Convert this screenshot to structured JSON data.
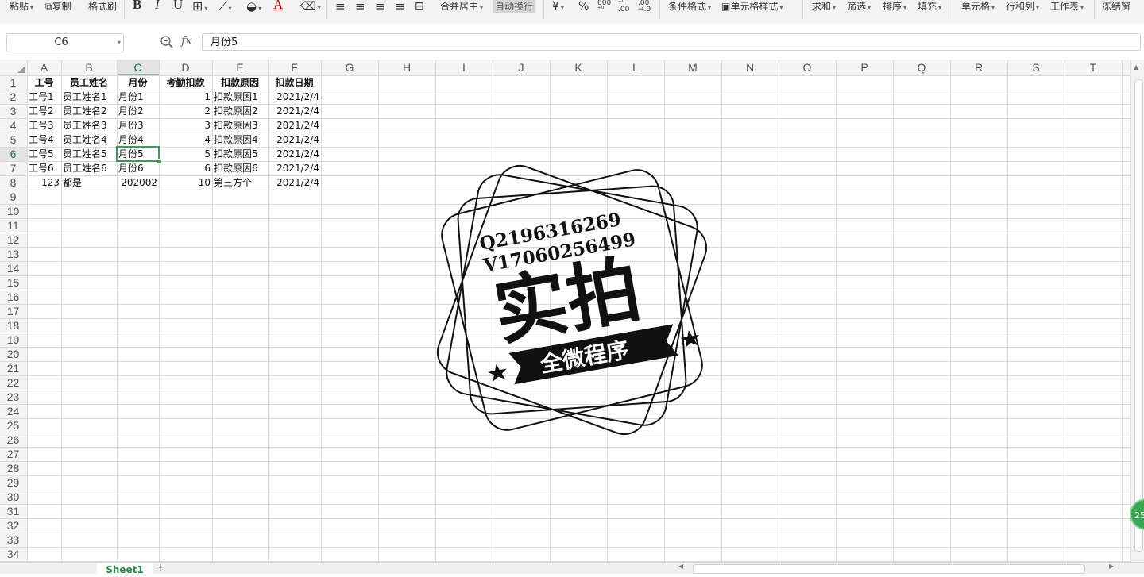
{
  "ribbon": {
    "paste": "粘贴",
    "copy": "复制",
    "format_painter": "格式刷",
    "merge_center": "合并居中",
    "wrap_text": "自动换行",
    "currency": "¥",
    "percent": "%",
    "cond_format": "条件格式",
    "cell_style": "单元格样式",
    "sum": "求和",
    "filter": "筛选",
    "sort": "排序",
    "fill": "填充",
    "cell": "单元格",
    "row_col": "行和列",
    "worksheet": "工作表",
    "freeze": "冻结窗"
  },
  "formula_bar": {
    "name_box": "C6",
    "fx_label": "fx",
    "formula": "月份5"
  },
  "columns": [
    "A",
    "B",
    "C",
    "D",
    "E",
    "F",
    "G",
    "H",
    "I",
    "J",
    "K",
    "L",
    "M",
    "N",
    "O",
    "P",
    "Q",
    "R",
    "S",
    "T"
  ],
  "rows": [
    "1",
    "2",
    "3",
    "4",
    "5",
    "6",
    "7",
    "8",
    "9",
    "10",
    "11",
    "12",
    "13",
    "14",
    "15",
    "16",
    "17",
    "18",
    "19",
    "20",
    "21",
    "22",
    "23",
    "24",
    "25",
    "26",
    "27",
    "28",
    "29",
    "30",
    "31",
    "32",
    "33",
    "34"
  ],
  "selected_cell": {
    "col": "C",
    "row": "6"
  },
  "table": {
    "headers": [
      "工号",
      "员工姓名",
      "月份",
      "考勤扣款",
      "扣款原因",
      "扣款日期"
    ],
    "rows": [
      [
        "工号1",
        "员工姓名1",
        "月份1",
        "1",
        "扣款原因1",
        "2021/2/4"
      ],
      [
        "工号2",
        "员工姓名2",
        "月份2",
        "2",
        "扣款原因2",
        "2021/2/4"
      ],
      [
        "工号3",
        "员工姓名3",
        "月份3",
        "3",
        "扣款原因3",
        "2021/2/4"
      ],
      [
        "工号4",
        "员工姓名4",
        "月份4",
        "4",
        "扣款原因4",
        "2021/2/4"
      ],
      [
        "工号5",
        "员工姓名5",
        "月份5",
        "5",
        "扣款原因5",
        "2021/2/4"
      ],
      [
        "工号6",
        "员工姓名6",
        "月份6",
        "6",
        "扣款原因6",
        "2021/2/4"
      ],
      [
        "123",
        "都是",
        "202002",
        "10",
        "第三方个",
        "2021/2/4"
      ]
    ]
  },
  "watermark": {
    "line1": "Q2196316269",
    "line2": "V17060256499",
    "main": "实拍",
    "banner": "全微程序"
  },
  "badge": "25",
  "sheet_tabs": [
    "Sheet1"
  ],
  "add_sheet": "+"
}
